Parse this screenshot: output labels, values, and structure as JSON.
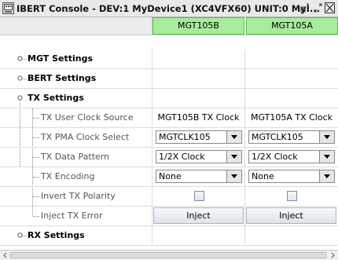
{
  "window": {
    "title": "IBERT Console - DEV:1 MyDevice1 (XC4VFX60) UNIT:0 MyI...",
    "icon": "console-icon"
  },
  "columns": [
    "MGT105B",
    "MGT105A"
  ],
  "sections": {
    "mgt": "MGT Settings",
    "bert": "BERT Settings",
    "tx": "TX Settings",
    "rx": "RX Settings"
  },
  "tx_rows": {
    "clock_source": {
      "label": "TX User Clock Source",
      "col1": "MGT105B TX Clock",
      "col2": "MGT105A TX Clock"
    },
    "pma_clock": {
      "label": "TX PMA Clock Select",
      "col1": "MGTCLK105",
      "col2": "MGTCLK105"
    },
    "data_pattern": {
      "label": "TX Data Pattern",
      "col1": "1/2X Clock",
      "col2": "1/2X Clock"
    },
    "encoding": {
      "label": "TX Encoding",
      "col1": "None",
      "col2": "None"
    },
    "invert_polarity": {
      "label": "Invert TX Polarity",
      "col1": false,
      "col2": false
    },
    "inject_error": {
      "label": "Inject TX Error",
      "col1": "Inject",
      "col2": "Inject"
    }
  },
  "colors": {
    "column_header_bg": "#a9eb9c",
    "column_header_border": "#55c24a"
  }
}
